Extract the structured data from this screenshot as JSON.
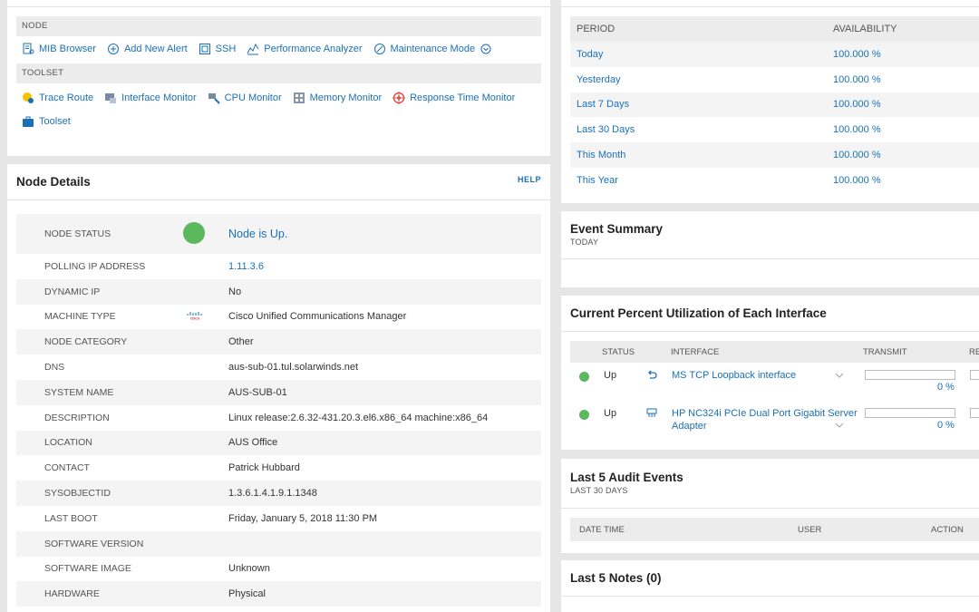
{
  "node_tools": {
    "node_header": "NODE",
    "node_items": [
      {
        "label": "MIB Browser",
        "icon": "mib-browser-icon"
      },
      {
        "label": "Add New Alert",
        "icon": "add-alert-icon"
      },
      {
        "label": "SSH",
        "icon": "ssh-icon"
      },
      {
        "label": "Performance Analyzer",
        "icon": "performance-analyzer-icon"
      },
      {
        "label": "Maintenance Mode",
        "icon": "maintenance-icon"
      }
    ],
    "toolset_header": "TOOLSET",
    "toolset_items": [
      {
        "label": "Trace Route",
        "icon": "trace-route-icon"
      },
      {
        "label": "Interface Monitor",
        "icon": "interface-monitor-icon"
      },
      {
        "label": "CPU Monitor",
        "icon": "cpu-monitor-icon"
      },
      {
        "label": "Memory Monitor",
        "icon": "memory-monitor-icon"
      },
      {
        "label": "Response Time Monitor",
        "icon": "response-time-icon"
      },
      {
        "label": "Toolset",
        "icon": "toolset-icon"
      }
    ]
  },
  "node_details": {
    "title": "Node Details",
    "help": "HELP",
    "rows": [
      {
        "key": "NODE STATUS",
        "value": "Node is Up."
      },
      {
        "key": "POLLING IP ADDRESS",
        "value": "1.11.3.6"
      },
      {
        "key": "DYNAMIC IP",
        "value": "No"
      },
      {
        "key": "MACHINE TYPE",
        "value": "Cisco Unified Communications Manager"
      },
      {
        "key": "NODE CATEGORY",
        "value": "Other"
      },
      {
        "key": "DNS",
        "value": "aus-sub-01.tul.solarwinds.net"
      },
      {
        "key": "SYSTEM NAME",
        "value": "AUS-SUB-01"
      },
      {
        "key": "DESCRIPTION",
        "value": "Linux release:2.6.32-431.20.3.el6.x86_64 machine:x86_64"
      },
      {
        "key": "LOCATION",
        "value": "AUS Office"
      },
      {
        "key": "CONTACT",
        "value": "Patrick Hubbard"
      },
      {
        "key": "SYSOBJECTID",
        "value": "1.3.6.1.4.1.9.1.1348"
      },
      {
        "key": "LAST BOOT",
        "value": "Friday, January 5, 2018 11:30 PM"
      },
      {
        "key": "SOFTWARE VERSION",
        "value": ""
      },
      {
        "key": "SOFTWARE IMAGE",
        "value": "Unknown"
      },
      {
        "key": "HARDWARE",
        "value": "Physical"
      }
    ],
    "cisco_logo_text": "cisco"
  },
  "availability": {
    "col_period": "PERIOD",
    "col_availability": "AVAILABILITY",
    "rows": [
      {
        "period": "Today",
        "value": "100.000 %"
      },
      {
        "period": "Yesterday",
        "value": "100.000 %"
      },
      {
        "period": "Last 7 Days",
        "value": "100.000 %"
      },
      {
        "period": "Last 30 Days",
        "value": "100.000 %"
      },
      {
        "period": "This Month",
        "value": "100.000 %"
      },
      {
        "period": "This Year",
        "value": "100.000 %"
      }
    ]
  },
  "event_summary": {
    "title": "Event Summary",
    "subtitle": "TODAY"
  },
  "utilization": {
    "title": "Current Percent Utilization of Each Interface",
    "col_status": "STATUS",
    "col_interface": "INTERFACE",
    "col_transmit": "TRANSMIT",
    "col_receive": "RE",
    "rows": [
      {
        "status": "Up",
        "interface": "MS TCP Loopback interface",
        "transmit": "0 %",
        "transmit_level": 0
      },
      {
        "status": "Up",
        "interface": "HP NC324i PCIe Dual Port Gigabit Server Adapter",
        "transmit": "0 %",
        "transmit_level": 0
      }
    ]
  },
  "audit": {
    "title": "Last 5 Audit Events",
    "subtitle": "LAST 30 DAYS",
    "col_datetime": "DATE TIME",
    "col_user": "USER",
    "col_action": "ACTION"
  },
  "notes": {
    "title": "Last 5 Notes (0)"
  },
  "colors": {
    "link": "#1a70b8",
    "status_up": "#5cb85c",
    "section_bg": "#ececec"
  }
}
